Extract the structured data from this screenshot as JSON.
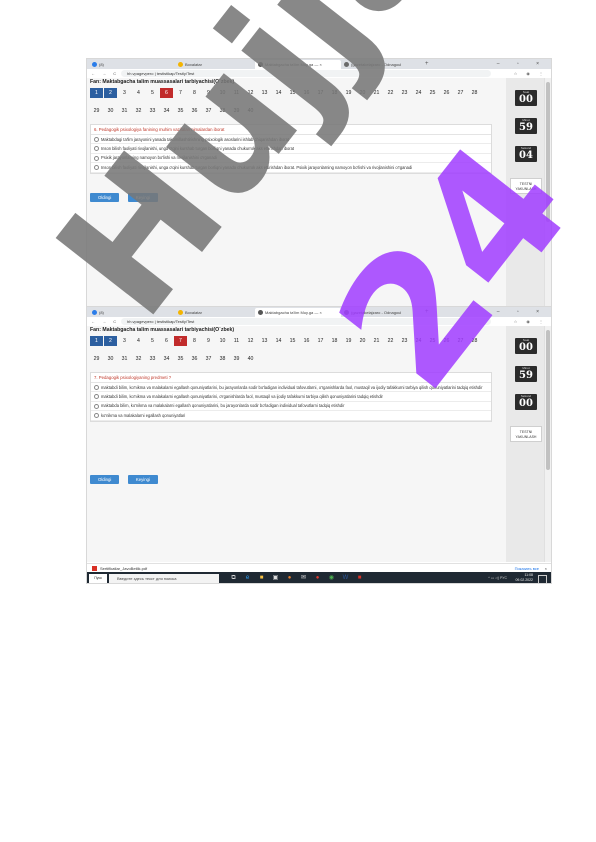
{
  "browser": {
    "tabs": [
      {
        "label": "(8)",
        "color": "#2b7de9"
      },
      {
        "label": "Boxalatar",
        "color": "#f4b400"
      },
      {
        "label": "Maktabgacha ta'lim Muy.ga — ×",
        "color": "#555555"
      },
      {
        "label": "(gazetakelajzaro - Odnagoul",
        "color": "#6a6a6a"
      }
    ],
    "new_tab": "+",
    "window_controls": "–  ▫  ×",
    "url": "hh.vpagevpero | testistikap/Testly/Test",
    "nav_symbols": "←  →  C"
  },
  "screens": [
    {
      "subject": "Fan: Maktabgacha talim muassasalari tarbiyachisi(O`zbek)",
      "numbers": [
        "1",
        "2",
        "3",
        "4",
        "5",
        "6",
        "7",
        "8",
        "9",
        "10",
        "11",
        "12",
        "13",
        "14",
        "15",
        "16",
        "17",
        "18",
        "19",
        "20",
        "21",
        "22",
        "23",
        "24",
        "25",
        "26",
        "27",
        "28",
        "29",
        "30",
        "31",
        "32",
        "33",
        "34",
        "35",
        "36",
        "37",
        "38",
        "39",
        "40"
      ],
      "answered": [
        "1",
        "2"
      ],
      "current": "6",
      "question": "6. Pedagogik psixologiya fanining muhim vazifalari nimalardan iborat",
      "options": [
        "Maktabdagi ta'lim jarayonini yanada takomillashtirishning psixologik asoslarini ishlab chiqarishdan iborat",
        "Inson bilish faoliyati rivojlanishi, unga o'qini kurshab turgan borliqni yanada chukurrok aks ettirishdan iborat",
        "Psixik jarayonlarning namoyon bo'lishi va rivojlanishini o'rganadi",
        "Inson bilish faoliyati rivojlanishi, unga o'qini kurshab turgan borliqni yanada chukurrok aks ettirishdan iborat. Psixik jarayonlarning namoyon bo'lishi va rivojlanishini o'rganadi"
      ],
      "buttons": [
        "Oldingi",
        "Keyingi"
      ],
      "timer": [
        {
          "label": "Soat",
          "value": "00"
        },
        {
          "label": "Minut",
          "value": "59"
        },
        {
          "label": "Sekund",
          "value": "04"
        }
      ]
    },
    {
      "subject": "Fan: Maktabgacha talim muassasalari tarbiyachisi(O`zbek)",
      "numbers": [
        "1",
        "2",
        "3",
        "4",
        "5",
        "6",
        "7",
        "8",
        "9",
        "10",
        "11",
        "12",
        "13",
        "14",
        "15",
        "16",
        "17",
        "18",
        "19",
        "20",
        "21",
        "22",
        "23",
        "24",
        "25",
        "26",
        "27",
        "28",
        "29",
        "30",
        "31",
        "32",
        "33",
        "34",
        "35",
        "36",
        "37",
        "38",
        "39",
        "40"
      ],
      "answered": [
        "1",
        "2"
      ],
      "current": "7",
      "question": "7. Pedagogik psixologiyaning predmeti ?",
      "options": [
        "maktabdi bilim, ko'nikma va malakalarni egallash qonuniyatlarini, bu jarayonlarda sodir bo'ladigan individual tafovutlarni, o'rganishlarda faol, mustaqil va ijodiy tafakkurni tarbiya qilish qonuniyatlarini tadqiq etishdir",
        "maktabdi bilim, ko'nikma va malakalarni egallash qonuniyatlarini, o'rganishlarda faol, mustaqil va ijodiy tafakkurni tarbiya qilish qonuniyatlarini tadqiq etishdir",
        "maktabda bilim, ko'nikma va malakalarni egallash qonuniyatlarini, bu jarayonlarda sodir bo'ladigan individual tafovutlarni tadqiq etishdir",
        "ko'nikma va malakalarni egallash qonuniyatlari"
      ],
      "buttons": [
        "Oldingi",
        "Keyingi"
      ],
      "timer": [
        {
          "label": "Soat",
          "value": "00"
        },
        {
          "label": "Minut",
          "value": "59"
        },
        {
          "label": "Sekund",
          "value": "00"
        }
      ]
    }
  ],
  "finish_button": "TESTNI YAKUNLASH",
  "download": {
    "file": "Sertifikatlar_JavoBetlik.pdf",
    "show_all": "Показать все",
    "close": "×"
  },
  "taskbar": {
    "start": "Пуск",
    "search": "Введите здесь текст для поиска",
    "time": "11:08",
    "date": "09.02.2022",
    "lang": "РУС"
  },
  "watermark": {
    "text1": "Hujjat",
    "text2": "24",
    "color1": "#808080",
    "color2": "#a040ff"
  },
  "colors": {
    "answered": "#2c5fa0",
    "current": "#c12b2b",
    "button": "#3f8ad0",
    "question": "#c0392b"
  }
}
